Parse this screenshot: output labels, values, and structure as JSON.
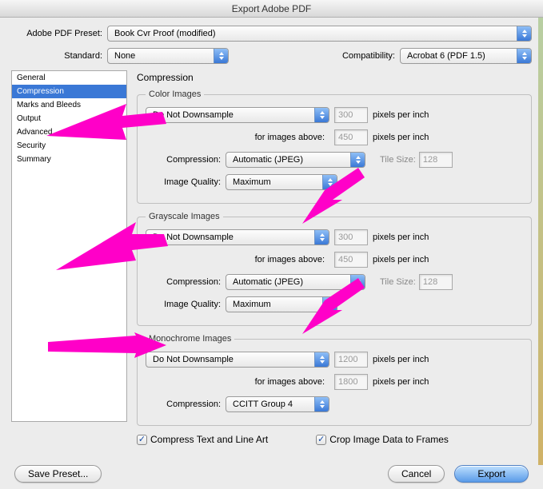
{
  "title": "Export Adobe PDF",
  "presetLabel": "Adobe PDF Preset:",
  "presetValue": "Book Cvr Proof (modified)",
  "standardLabel": "Standard:",
  "standardValue": "None",
  "compatLabel": "Compatibility:",
  "compatValue": "Acrobat 6 (PDF 1.5)",
  "sidebar": {
    "items": [
      "General",
      "Compression",
      "Marks and Bleeds",
      "Output",
      "Advanced",
      "Security",
      "Summary"
    ],
    "selectedIndex": 1
  },
  "panelTitle": "Compression",
  "labels": {
    "ppi": "pixels per inch",
    "forAbove": "for images above:",
    "compression": "Compression:",
    "imageQuality": "Image Quality:",
    "tileSize": "Tile Size:"
  },
  "groups": {
    "color": {
      "legend": "Color Images",
      "downsample": "Do Not Downsample",
      "ppi": "300",
      "abovePpi": "450",
      "compression": "Automatic (JPEG)",
      "tile": "128",
      "quality": "Maximum"
    },
    "gray": {
      "legend": "Grayscale Images",
      "downsample": "Do Not Downsample",
      "ppi": "300",
      "abovePpi": "450",
      "compression": "Automatic (JPEG)",
      "tile": "128",
      "quality": "Maximum"
    },
    "mono": {
      "legend": "Monochrome Images",
      "downsample": "Do Not Downsample",
      "ppi": "1200",
      "abovePpi": "1800",
      "compression": "CCITT Group 4"
    }
  },
  "checks": {
    "compressText": "Compress Text and Line Art",
    "cropImage": "Crop Image Data to Frames"
  },
  "buttons": {
    "savePreset": "Save Preset...",
    "cancel": "Cancel",
    "export": "Export"
  }
}
